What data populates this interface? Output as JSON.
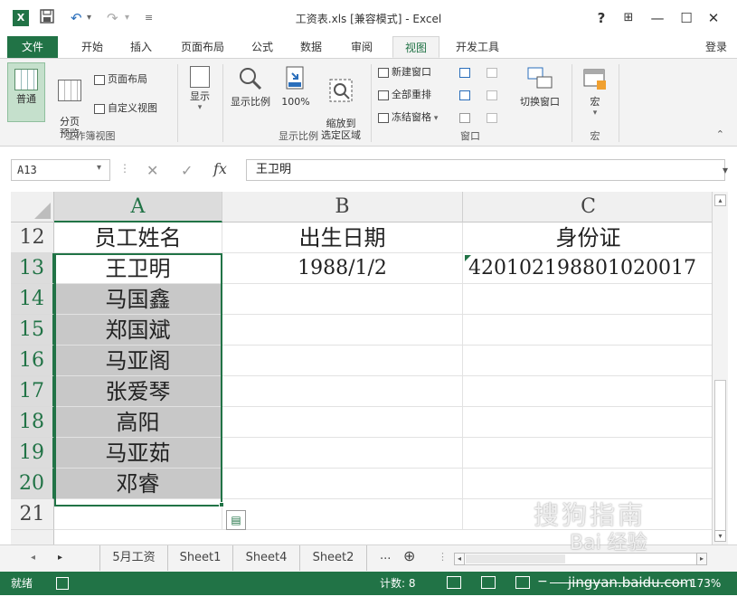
{
  "window": {
    "title": "工资表.xls  [兼容模式] - Excel",
    "help": "?",
    "ribbon_display": "⊞",
    "minimize": "—",
    "maximize": "☐",
    "close": "✕",
    "undo": "↶",
    "redo": "↷",
    "qat_customize": "▾"
  },
  "ribbon_tabs": [
    {
      "label": "文件"
    },
    {
      "label": "开始"
    },
    {
      "label": "插入"
    },
    {
      "label": "页面布局"
    },
    {
      "label": "公式"
    },
    {
      "label": "数据"
    },
    {
      "label": "审阅"
    },
    {
      "label": "视图",
      "active": true
    },
    {
      "label": "开发工具"
    }
  ],
  "account": "登录",
  "ribbon": {
    "workbook_views": {
      "group_label": "工作簿视图",
      "normal": "普通",
      "page_break_preview": "分页\n预览",
      "page_layout": "页面布局",
      "custom_views": "自定义视图"
    },
    "show": {
      "label": "显示"
    },
    "zoom": {
      "group_label": "显示比例",
      "zoom": "显示比例",
      "zoom_100": "100%",
      "zoom_to_selection": "缩放到\n选定区域"
    },
    "window": {
      "group_label": "窗口",
      "new_window": "新建窗口",
      "arrange_all": "全部重排",
      "freeze_panes": "冻结窗格",
      "switch_windows": "切换窗口"
    },
    "macros": {
      "group_label": "宏",
      "macros": "宏"
    }
  },
  "formula_bar": {
    "name_box": "A13",
    "cancel_icon": "✕",
    "enter_icon": "✓",
    "fx": "fx",
    "value": "王卫明"
  },
  "grid": {
    "columns": [
      "A",
      "B",
      "C"
    ],
    "rows": [
      "12",
      "13",
      "14",
      "15",
      "16",
      "17",
      "18",
      "19",
      "20",
      "21"
    ],
    "cells": {
      "A12": "员工姓名",
      "B12": "出生日期",
      "C12": "身份证",
      "A13": "王卫明",
      "B13": "1988/1/2",
      "C13": "420102198801020017",
      "A14": "马国鑫",
      "A15": "郑国斌",
      "A16": "马亚阁",
      "A17": "张爱琴",
      "A18": "高阳",
      "A19": "马亚茹",
      "A20": "邓睿"
    },
    "active_cell": "A13",
    "selection": "A13:A20"
  },
  "sheet_tabs": {
    "tabs": [
      "5月工资",
      "Sheet1",
      "Sheet4",
      "Sheet2"
    ],
    "more": "...",
    "add": "⊕"
  },
  "status_bar": {
    "ready": "就绪",
    "count_label": "计数: 8",
    "zoom_text": "173%"
  },
  "watermark": {
    "line1": "搜狗指南",
    "line2": "Bai 经验",
    "line3": "jingyan.baidu.com"
  }
}
